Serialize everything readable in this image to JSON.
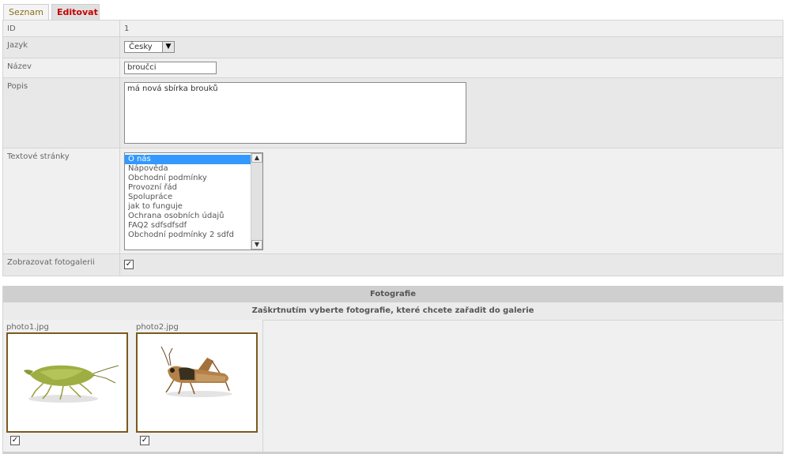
{
  "tabs": [
    {
      "label": "Seznam",
      "active": false
    },
    {
      "label": "Editovat",
      "active": true
    }
  ],
  "form": {
    "id_label": "ID",
    "id_value": "1",
    "language_label": "Jazyk",
    "language_value": "Česky",
    "name_label": "Název",
    "name_value": "broučci",
    "description_label": "Popis",
    "description_value": "má nová sbírka brouků",
    "pages_label": "Textové stránky",
    "pages_options": [
      "O nás",
      "Nápověda",
      "Obchodní podmínky",
      "Provozní řád",
      "Spolupráce",
      "jak to funguje",
      "Ochrana osobních údajů",
      "FAQ2 sdfsdfsdf",
      "Obchodní podmínky 2 sdfd"
    ],
    "pages_selected": "O nás",
    "show_gallery_label": "Zobrazovat fotogalerii",
    "show_gallery_checked": true
  },
  "photos": {
    "title": "Fotografie",
    "subtitle": "Zaškrtnutím vyberte fotografie, které chcete zařadit do galerie",
    "items": [
      {
        "filename": "photo1.jpg",
        "subject": "green-stink-bug",
        "checked": true
      },
      {
        "filename": "photo2.jpg",
        "subject": "grasshopper",
        "checked": true
      }
    ]
  },
  "colors": {
    "tab_active_text": "#c40000",
    "tab_inactive_text": "#8a6d1e",
    "photo_frame": "#7a5a1e",
    "selection": "#3399ff"
  }
}
